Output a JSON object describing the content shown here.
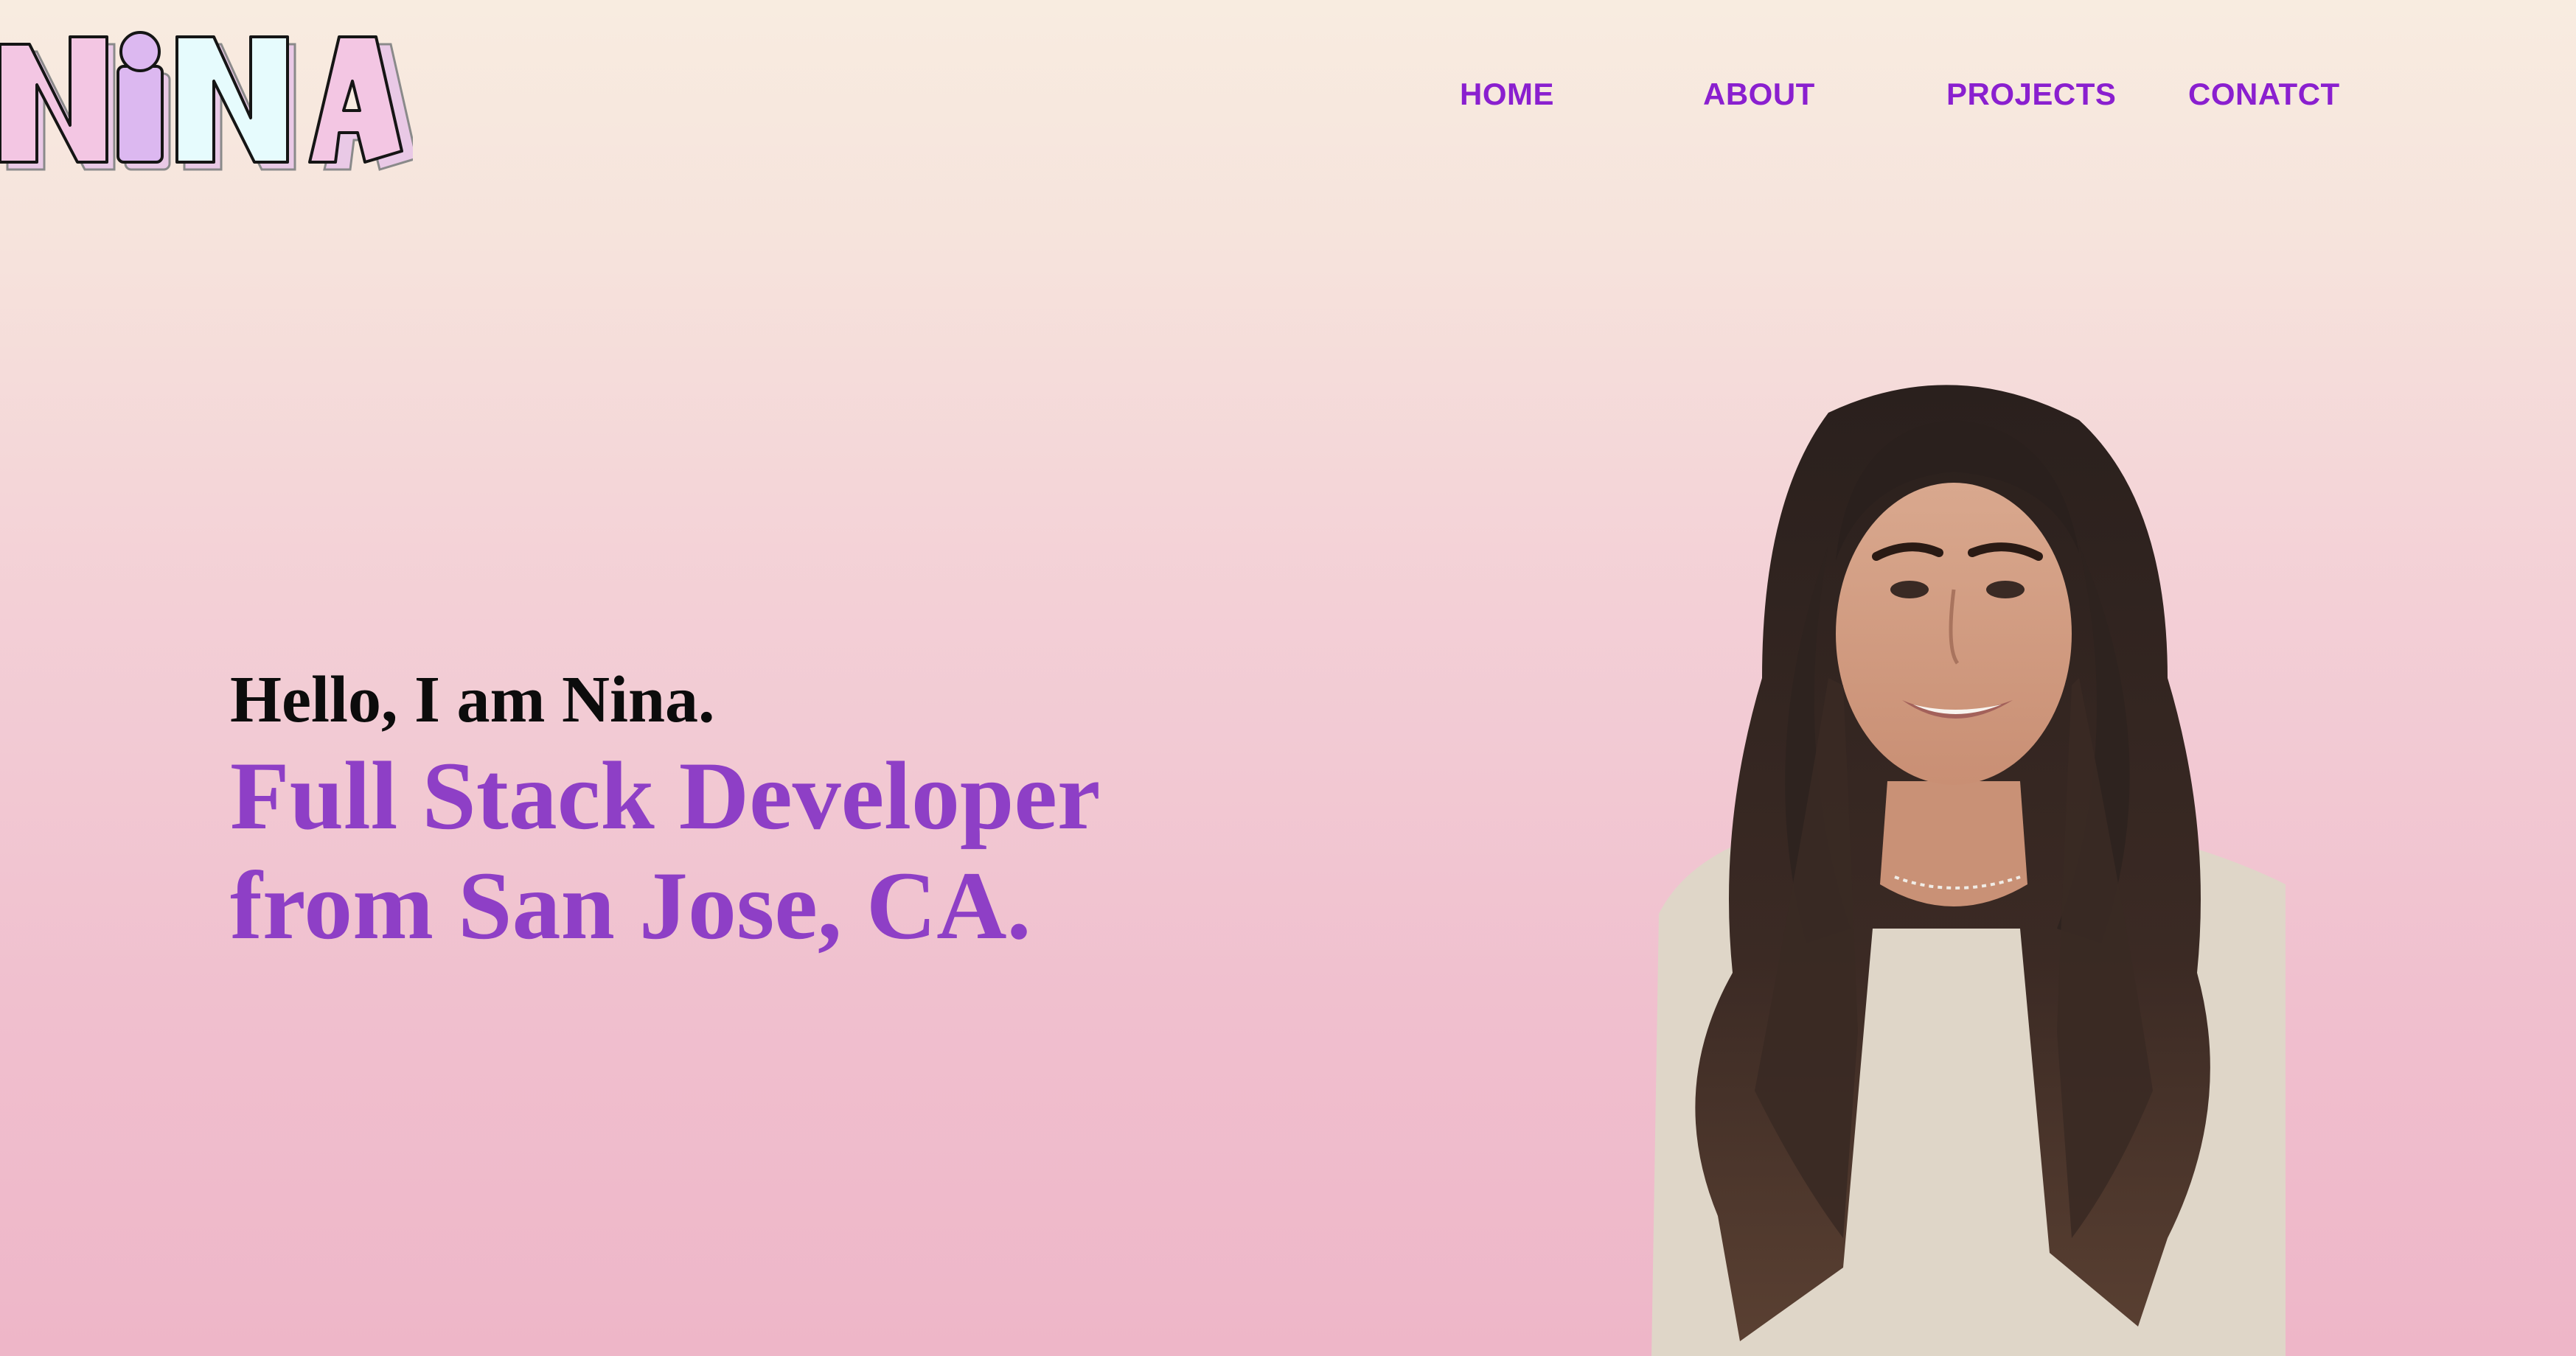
{
  "brand": {
    "logo_text": "NiNA"
  },
  "nav": {
    "items": [
      {
        "label": "HOME"
      },
      {
        "label": "ABOUT"
      },
      {
        "label": "PROJECTS"
      },
      {
        "label": "CONATCT"
      }
    ]
  },
  "hero": {
    "greeting": "Hello, I am Nina.",
    "role_line1": "Full Stack Developer",
    "role_line2": "from San Jose, CA."
  },
  "colors": {
    "accent": "#8a1fcf",
    "role_text": "#8e3fc6",
    "background_top": "#f8ece0",
    "background_bottom": "#eeb6c8",
    "logo_pink": "#f3c6e3",
    "logo_lavender": "#dcb8f0",
    "logo_cyan": "#e6fbfd"
  },
  "icons": {
    "portrait": "profile-photo"
  }
}
